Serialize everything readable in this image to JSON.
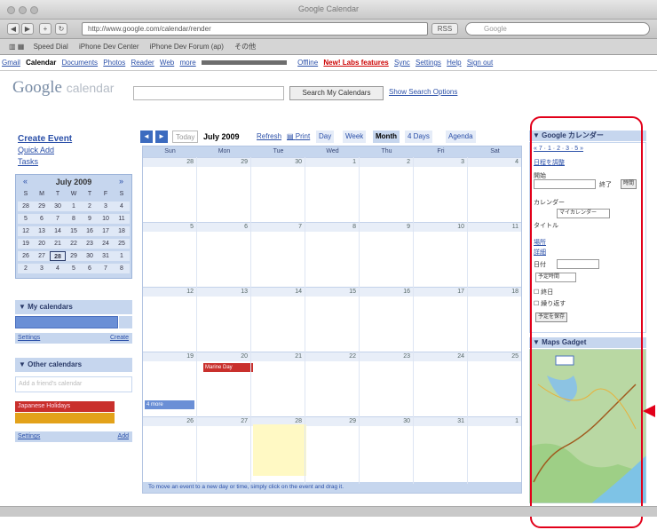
{
  "window": {
    "title": "Google Calendar"
  },
  "browser": {
    "url": "http://www.google.com/calendar/render",
    "search_placeholder": "Google",
    "bookmarks": [
      "Speed Dial",
      "iPhone Dev Center",
      "iPhone Dev Forum (ap)",
      "その他"
    ]
  },
  "gbar": {
    "items": [
      "Gmail",
      "Calendar",
      "Documents",
      "Photos",
      "Reader",
      "Web",
      "more"
    ],
    "right_items": [
      "Offline",
      "New! Labs features",
      "Sync",
      "Settings",
      "Help",
      "Sign out"
    ]
  },
  "logo": {
    "google": "Google",
    "calendar": "calendar"
  },
  "search": {
    "button": "Search My Calendars",
    "options": "Show Search Options"
  },
  "sidebar": {
    "create_event": "Create Event",
    "quick_add": "Quick Add",
    "tasks": "Tasks",
    "mini_cal": {
      "title": "July 2009",
      "prev": "«",
      "next": "»",
      "weekdays": [
        "S",
        "M",
        "T",
        "W",
        "T",
        "F",
        "S"
      ],
      "rows": [
        [
          "28",
          "29",
          "30",
          "1",
          "2",
          "3",
          "4"
        ],
        [
          "5",
          "6",
          "7",
          "8",
          "9",
          "10",
          "11"
        ],
        [
          "12",
          "13",
          "14",
          "15",
          "16",
          "17",
          "18"
        ],
        [
          "19",
          "20",
          "21",
          "22",
          "23",
          "24",
          "25"
        ],
        [
          "26",
          "27",
          "28",
          "29",
          "30",
          "31",
          "1"
        ],
        [
          "2",
          "3",
          "4",
          "5",
          "6",
          "7",
          "8"
        ]
      ]
    },
    "my_calendars": {
      "title": "My calendars",
      "settings": "Settings",
      "create": "Create"
    },
    "other_calendars": {
      "title": "Other calendars",
      "add_placeholder": "Add a friend's calendar",
      "item1": "Japanese Holidays",
      "settings": "Settings",
      "add": "Add"
    }
  },
  "toolbar": {
    "prev": "◄",
    "next": "►",
    "today": "Today",
    "date_range": "July 2009",
    "refresh": "Refresh",
    "print": "Print",
    "views": [
      "Day",
      "Week",
      "Month",
      "4 Days",
      "Agenda"
    ]
  },
  "grid": {
    "weekdays": [
      "Sun",
      "Mon",
      "Tue",
      "Wed",
      "Thu",
      "Fri",
      "Sat"
    ],
    "weeks": [
      [
        "28",
        "29",
        "30",
        "1",
        "2",
        "3",
        "4"
      ],
      [
        "5",
        "6",
        "7",
        "8",
        "9",
        "10",
        "11"
      ],
      [
        "12",
        "13",
        "14",
        "15",
        "16",
        "17",
        "18"
      ],
      [
        "19",
        "20",
        "21",
        "22",
        "23",
        "24",
        "25"
      ],
      [
        "26",
        "27",
        "28",
        "29",
        "30",
        "31",
        "1"
      ]
    ],
    "event_red": "Marine Day",
    "event_blue": "4 more",
    "tip": "To move an event to a new day or time, simply click on the event and drag it."
  },
  "right_panel": {
    "title": "Google カレンダー",
    "l1": "« 7 · 1 · 2 · 3 · 5 »",
    "l2": "日程を調整",
    "from_label": "開始",
    "to_label": "終了",
    "time_btn": "時間",
    "l3": "カレンダー",
    "cal_value": "マイカレンダー",
    "l4": "タイトル",
    "l5": "場所",
    "l6": "詳細",
    "l7": "日付",
    "l8": "予定時間",
    "check1": "終日",
    "check2": "繰り返す",
    "check3": "予定を追加",
    "save": "予定を保存",
    "map_title": "Maps Gadget"
  }
}
